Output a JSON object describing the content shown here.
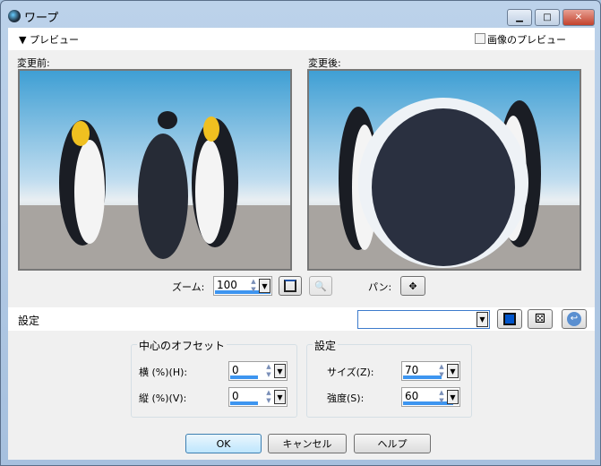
{
  "window": {
    "title": "ワープ",
    "minimize": "▁",
    "maximize": "□",
    "close": "✕"
  },
  "preview_header": {
    "toggle_label": "プレビュー",
    "image_preview_label": "画像のプレビュー",
    "image_preview_checked": false
  },
  "previews": {
    "before_label": "変更前:",
    "after_label": "変更後:"
  },
  "zoom": {
    "label": "ズーム:",
    "value": "100",
    "fill": 1.0,
    "pan_label": "パン:"
  },
  "settings_bar": {
    "label": "設定",
    "preset_value": ""
  },
  "offset_group": {
    "title": "中心のオフセット",
    "horizontal_label": "横 (%)(H):",
    "horizontal_value": "0",
    "horizontal_fill": 0.5,
    "vertical_label": "縦 (%)(V):",
    "vertical_value": "0",
    "vertical_fill": 0.5
  },
  "settings_group": {
    "title": "設定",
    "size_label": "サイズ(Z):",
    "size_value": "70",
    "size_fill": 0.7,
    "strength_label": "強度(S):",
    "strength_value": "60",
    "strength_fill": 0.9
  },
  "buttons": {
    "ok": "OK",
    "cancel": "キャンセル",
    "help": "ヘルプ"
  }
}
